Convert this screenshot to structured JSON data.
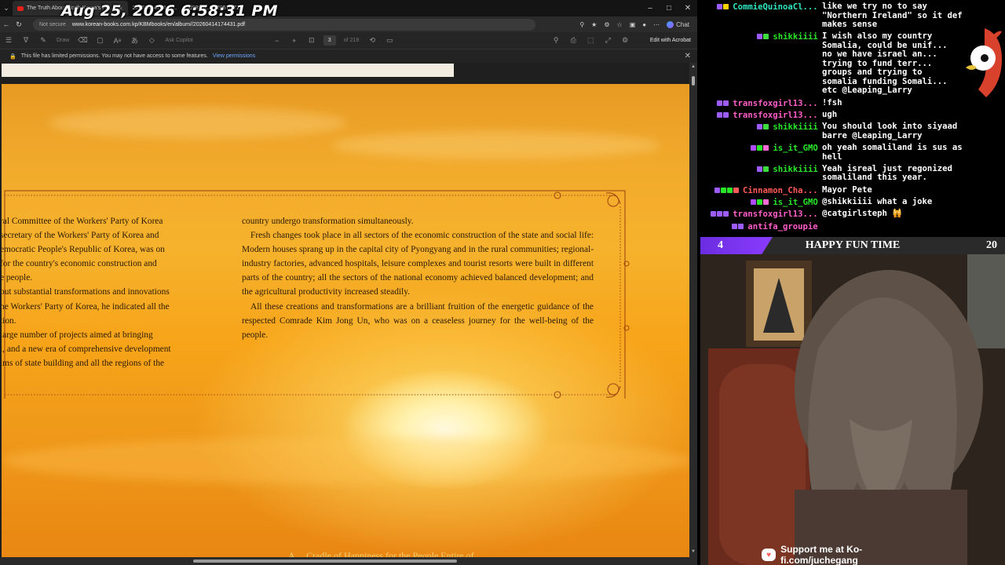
{
  "browser": {
    "tabs": [
      {
        "label": "The Truth About North Korea's Hi...",
        "active": true
      },
      {
        "label": "2026041417443..."
      },
      {
        "label": "bd98f96...7420576f72..."
      }
    ],
    "overlay_datetime": "Aug 25, 2026 6:58:31 PM",
    "address": {
      "security": "Not secure",
      "url": "www.korean-books.com.kp/KBMbooks/en/album//20260414174431.pdf"
    },
    "chat_label": "Chat",
    "window_controls": {
      "minimize": "–",
      "maximize": "□",
      "close": "✕"
    }
  },
  "pdf_toolbar": {
    "draw_label": "Draw",
    "ask_copilot_label": "Ask Copilot",
    "page_current": "3",
    "page_total": "of 219",
    "edit_label": "Edit with Acrobat"
  },
  "permissions_bar": {
    "message": "This file has limited permissions. You may not have access to some features.",
    "link": "View permissions"
  },
  "pdf_page": {
    "left_column": [
      "ral Committee of the Workers' Party of Korea",
      "secretary of the Workers' Party of Korea and",
      "emocratic People's Republic of Korea, was on",
      " for the country's economic construction and",
      "e people.",
      "out substantial transformations and innovations",
      "he Workers' Party of Korea, he indicated all the",
      "tion.",
      " large number of projects aimed at bringing",
      "l, and a new era of comprehensive development",
      "lms of state building and all the regions of the"
    ],
    "right_paragraphs": [
      "country undergo transformation simultaneously.",
      "Fresh changes took place in all sectors of the economic construction of the state and social life: Modern houses sprang up in the capital city of Pyongyang and in the rural communities; regional-industry factories, advanced hospitals, leisure complexes and tourist resorts were built in different parts of the country; all the sectors of the national economy achieved balanced development; and the agricultural productivity increased steadily.",
      "All these creations and transformations are a brilliant fruition of the energetic guidance of the respected Comrade Kim Jong Un, who was on a ceaseless journey for the well-being of the people."
    ],
    "footer_caption": "A ... Cradle of Happiness for the People Entire of ..."
  },
  "chat": {
    "messages": [
      {
        "user": "CommieQuinoaCl...",
        "color": "#2fe6c0",
        "text": "like we try no to say\n\"Northern Ireland\" so it def\nmakes sense",
        "badges": [
          "#9d5cff",
          "#ffd100"
        ]
      },
      {
        "user": "shikkiiii",
        "color": "#29e629",
        "text": "I wish also my country\nSomalia, could be unif...\nno we have israel an...\ntrying to fund terr...\ngroups and trying to\nsomalia funding Somali...\netc @Leaping_Larry",
        "badges": [
          "#9d5cff",
          "#3ddc3d"
        ]
      },
      {
        "user": "transfoxgirl13...",
        "color": "#ff5ec8",
        "text": "!fsh",
        "badges": [
          "#9d5cff",
          "#9d5cff"
        ]
      },
      {
        "user": "transfoxgirl13...",
        "color": "#ff5ec8",
        "text": "ugh",
        "badges": [
          "#9d5cff",
          "#9d5cff"
        ]
      },
      {
        "user": "shikkiiii",
        "color": "#29e629",
        "text": "You should look into siyaad\nbarre @Leaping_Larry",
        "badges": [
          "#9d5cff",
          "#3ddc3d"
        ]
      },
      {
        "user": "is_it_GMO",
        "color": "#29e629",
        "text": "oh yeah somaliland is sus as\nhell",
        "badges": [
          "#b04cff",
          "#29e629",
          "#ff6ad5"
        ]
      },
      {
        "user": "shikkiiii",
        "color": "#29e629",
        "text": "Yeah isreal just regonized\nsomaliland this year.",
        "badges": [
          "#9d5cff",
          "#3ddc3d"
        ]
      },
      {
        "user": "Cinnamon_Cha...",
        "color": "#ff5a5a",
        "text": "Mayor Pete",
        "badges": [
          "#9d5cff",
          "#29e629",
          "#29e629",
          "#ff5a5a"
        ]
      },
      {
        "user": "is_it_GMO",
        "color": "#29e629",
        "text": "@shikkiiii what a joke",
        "badges": [
          "#b04cff",
          "#29e629",
          "#ff6ad5"
        ]
      },
      {
        "user": "transfoxgirl13...",
        "color": "#ff5ec8",
        "text": "@catgirlsteph 🙀",
        "badges": [
          "#9d5cff",
          "#9d5cff",
          "#9d5cff"
        ]
      },
      {
        "user": "antifa_groupie",
        "color": "#ff5ec8",
        "text": "",
        "badges": [
          "#9d5cff",
          "#9d5cff"
        ]
      }
    ]
  },
  "webcam": {
    "left_number": "4",
    "title": "HAPPY FUN TIME",
    "right_number": "20"
  },
  "kofi": {
    "text": "Support me at Ko-fi.com/juchegang"
  }
}
